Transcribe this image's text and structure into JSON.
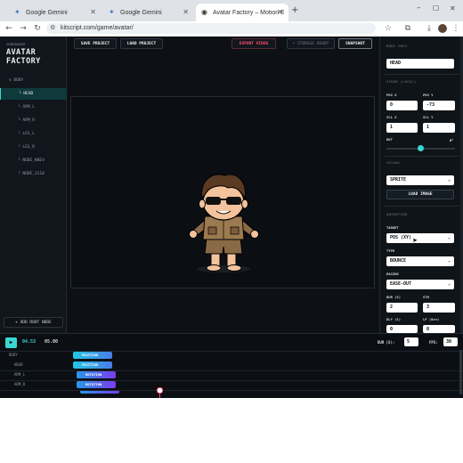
{
  "browser": {
    "tabs": [
      {
        "title": "Google Gemini"
      },
      {
        "title": "Google Gemini"
      },
      {
        "title": "Avatar Factory – Motion Editor"
      }
    ],
    "url": "kitscript.com/game/avatar/"
  },
  "app": {
    "brand_sub": "SOMEBODER",
    "brand_title": "AVATAR FACTORY",
    "tree": [
      {
        "label": "∨ BODY",
        "selected": false
      },
      {
        "label": "└ HEAD",
        "selected": true
      },
      {
        "label": "└ ARM_L",
        "selected": false
      },
      {
        "label": "└ ARM_R",
        "selected": false
      },
      {
        "label": "└ LEG_L",
        "selected": false
      },
      {
        "label": "└ LEG_R",
        "selected": false
      },
      {
        "label": "└ NODE_KNEV",
        "selected": false
      },
      {
        "label": "└ NODE_2110",
        "selected": false
      }
    ],
    "add_root": "+ ADD ROOT NODE",
    "toolbar": {
      "save": "SAVE PROJECT",
      "load": "LOAD PROJECT",
      "export": "EXPORT VIDEO",
      "storage": "• STORAGE READY",
      "snapshot": "SNAPSHOT"
    },
    "right": {
      "node_info": "NODE INFO",
      "node_name": "HEAD",
      "xform": "XFORM (LOCAL)",
      "pos_x_label": "POS X",
      "pos_y_label": "POS Y",
      "pos_x": "0",
      "pos_y": "-73",
      "scl_x_label": "SCL X",
      "scl_y_label": "SCL Y",
      "scl_x": "1",
      "scl_y": "1",
      "rot_label": "ROT",
      "rot_value": "0°",
      "visual": "VISUAL",
      "visual_type": "SPRITE",
      "load_image": "LOAD IMAGE",
      "animation": "ANIMATION",
      "target_label": "TARGET",
      "target_value": "POS (XY)",
      "type_label": "TYPE",
      "type_value": "BOUNCE",
      "easing_label": "EASING",
      "easing_value": "EASE-OUT",
      "dur_label": "DUR (S)",
      "str_label": "STR",
      "dur_value": "2",
      "str_value": "3",
      "dly_label": "DLY (S)",
      "lp_label": "LP (0=∞)",
      "dly_value": "0",
      "lp_value": "0"
    },
    "timeline": {
      "time_current": "04.53",
      "time_total": "05.00",
      "dur_label": "DUR (S):",
      "dur_value": "5",
      "fps_label": "FPS:",
      "fps_value": "30",
      "tracks": [
        {
          "name": "BODY",
          "clip": "POSITION"
        },
        {
          "name": "HEAD",
          "clip": "POSITION"
        },
        {
          "name": "ARM_L",
          "clip": "ROTATION"
        },
        {
          "name": "ARM_R",
          "clip": "ROTATION"
        }
      ]
    },
    "colors": {
      "accent": "#3ad8d2",
      "bg": "#0d1116",
      "export": "#ff4d6d",
      "clip_from": "#22c8e6",
      "clip_to": "#7a3cf0"
    }
  }
}
